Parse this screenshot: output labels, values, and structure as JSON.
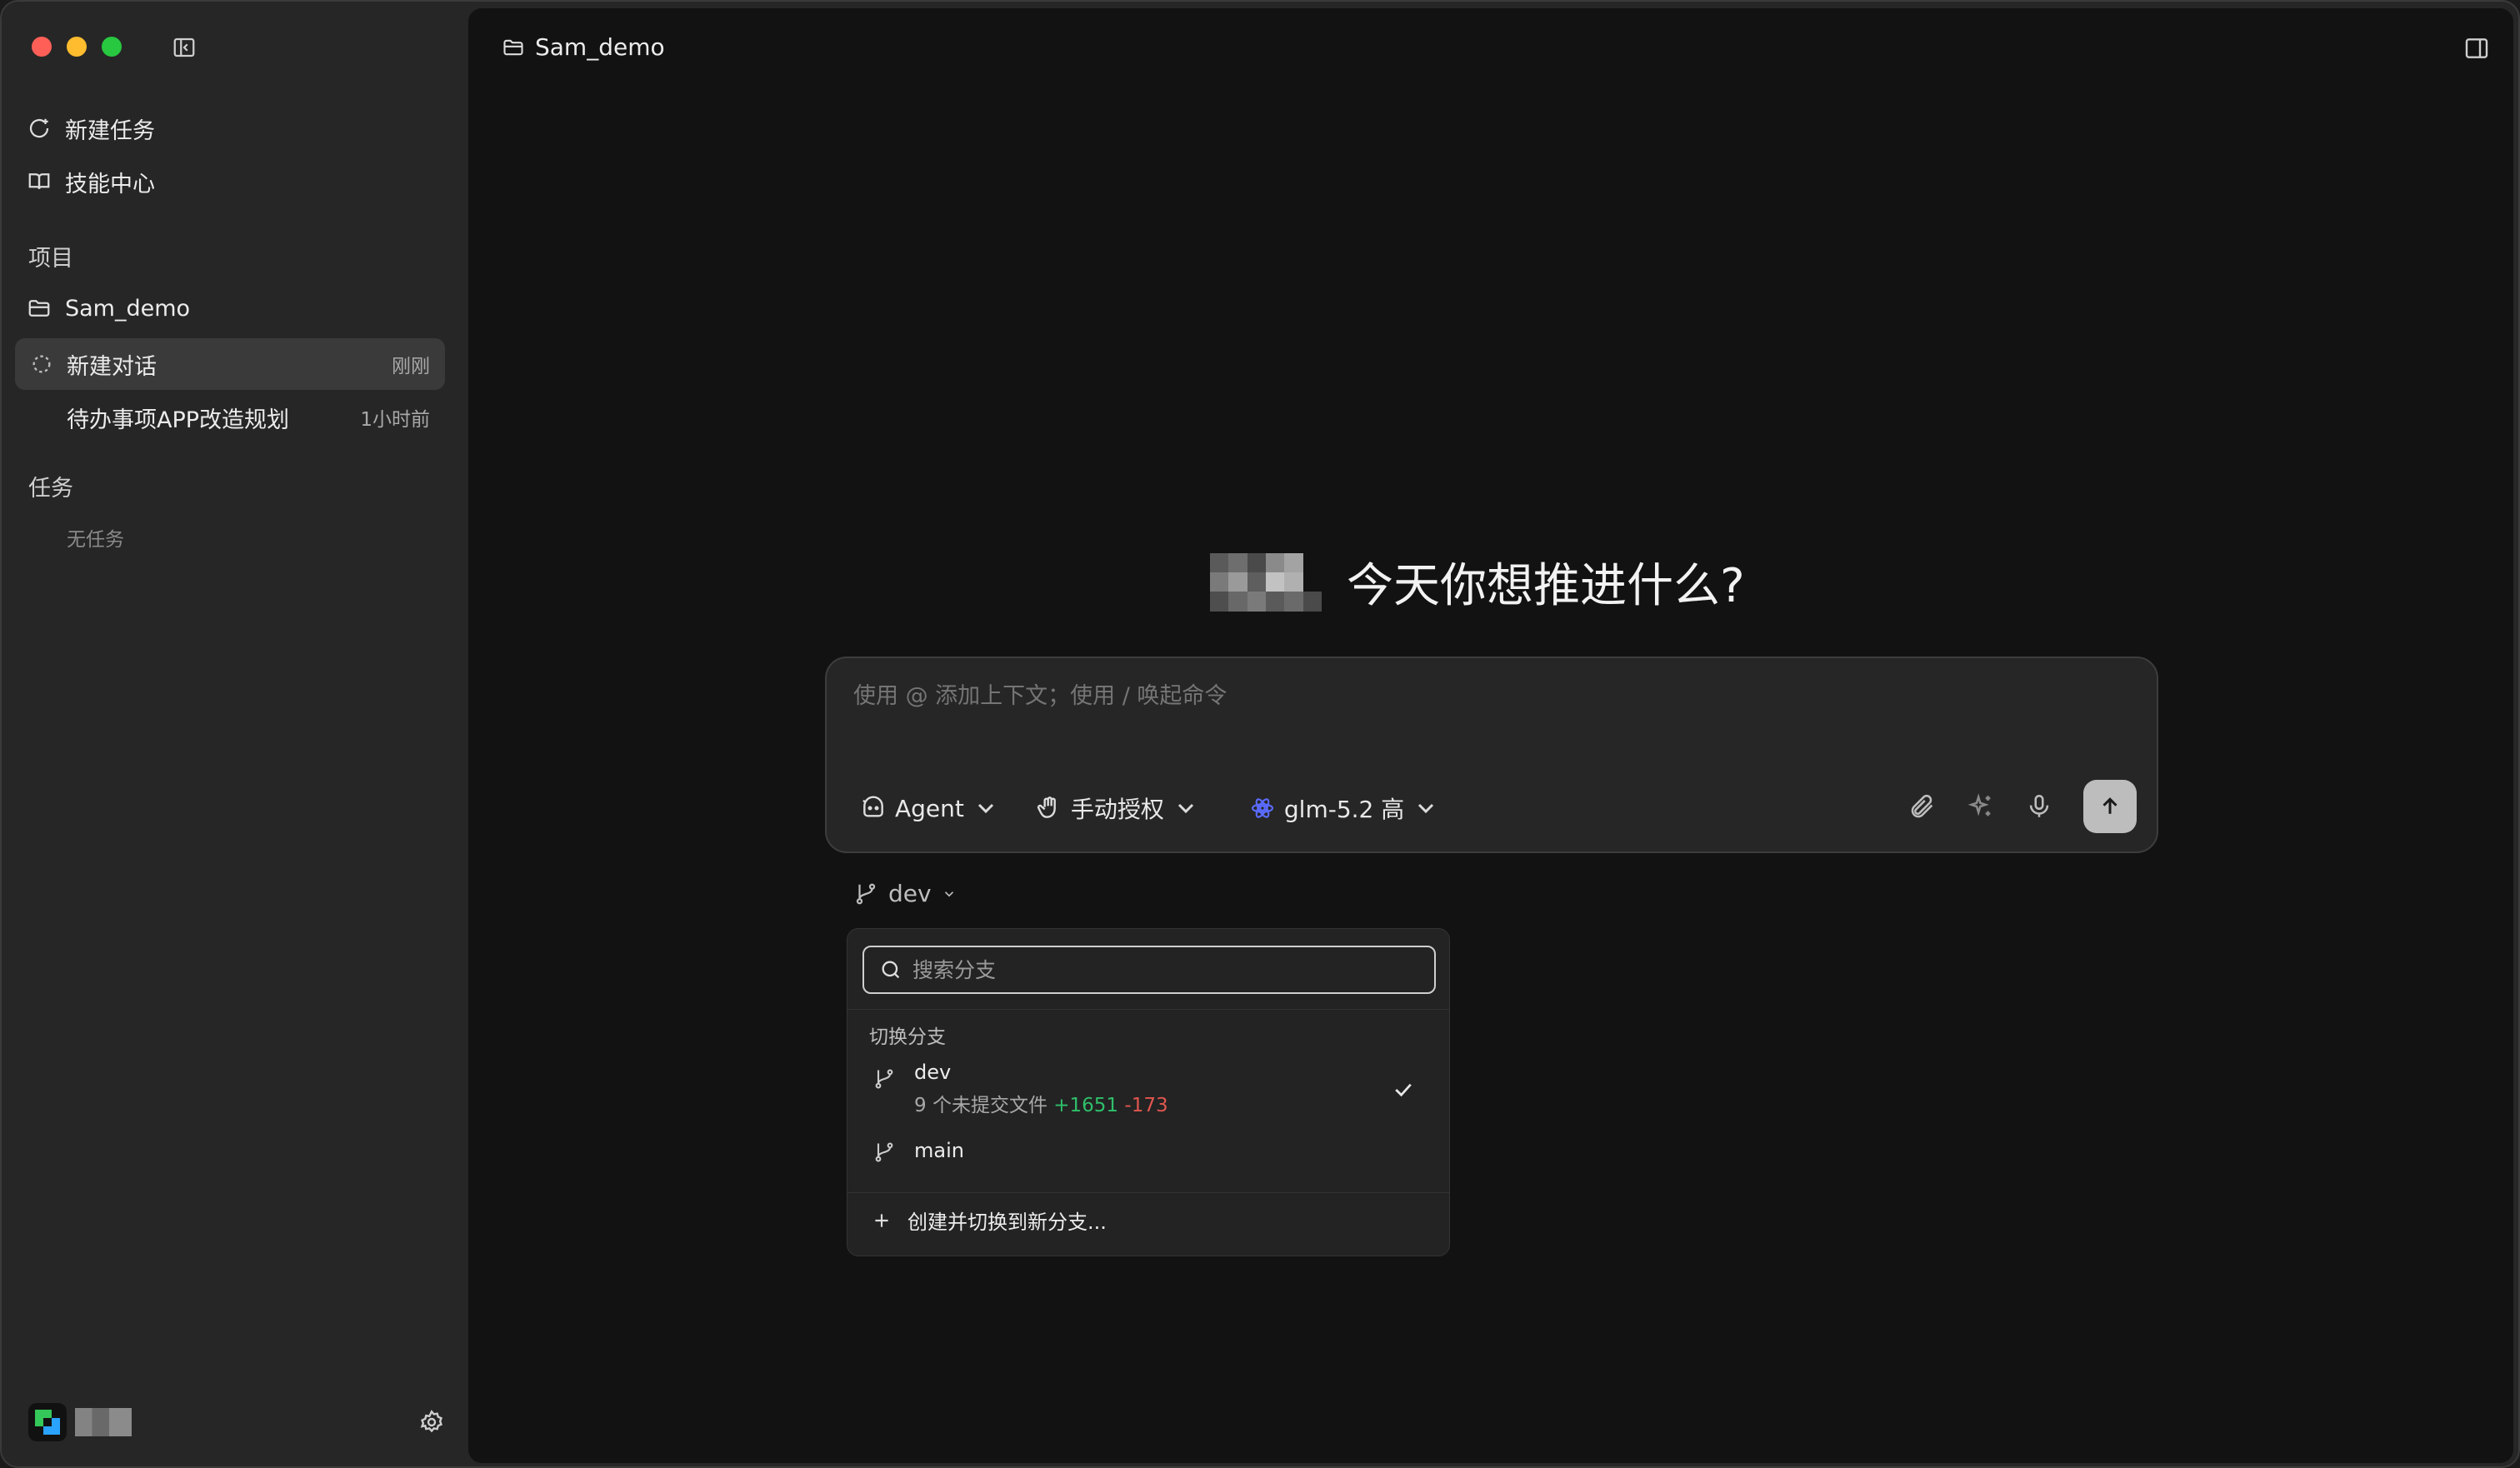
{
  "sidebar": {
    "nav": [
      {
        "label": "新建任务",
        "icon": "new-task-icon"
      },
      {
        "label": "技能中心",
        "icon": "book-icon"
      }
    ],
    "projects_title": "项目",
    "project": {
      "label": "Sam_demo",
      "icon": "folder-icon"
    },
    "conversations": [
      {
        "title": "新建对话",
        "time": "刚刚",
        "active": true
      },
      {
        "title": "待办事项APP改造规划",
        "time": "1小时前",
        "active": false
      }
    ],
    "tasks_title": "任务",
    "tasks_empty": "无任务"
  },
  "header": {
    "project": "Sam_demo"
  },
  "main": {
    "greeting": "今天你想推进什么?",
    "composer": {
      "placeholder": "使用 @ 添加上下文；使用 / 唤起命令",
      "mode": "Agent",
      "permission": "手动授权",
      "model": "glm-5.2 高"
    },
    "branch": {
      "current": "dev",
      "search_placeholder": "搜索分支",
      "section_title": "切换分支",
      "items": [
        {
          "name": "dev",
          "uncommitted": "9 个未提交文件",
          "plus": "+1651",
          "minus": "-173",
          "selected": true
        },
        {
          "name": "main",
          "selected": false
        }
      ],
      "create_label": "创建并切换到新分支..."
    }
  },
  "colors": {
    "accent_green": "#2fbf6a",
    "accent_red": "#e0564f",
    "model_icon": "#5b6cff"
  }
}
